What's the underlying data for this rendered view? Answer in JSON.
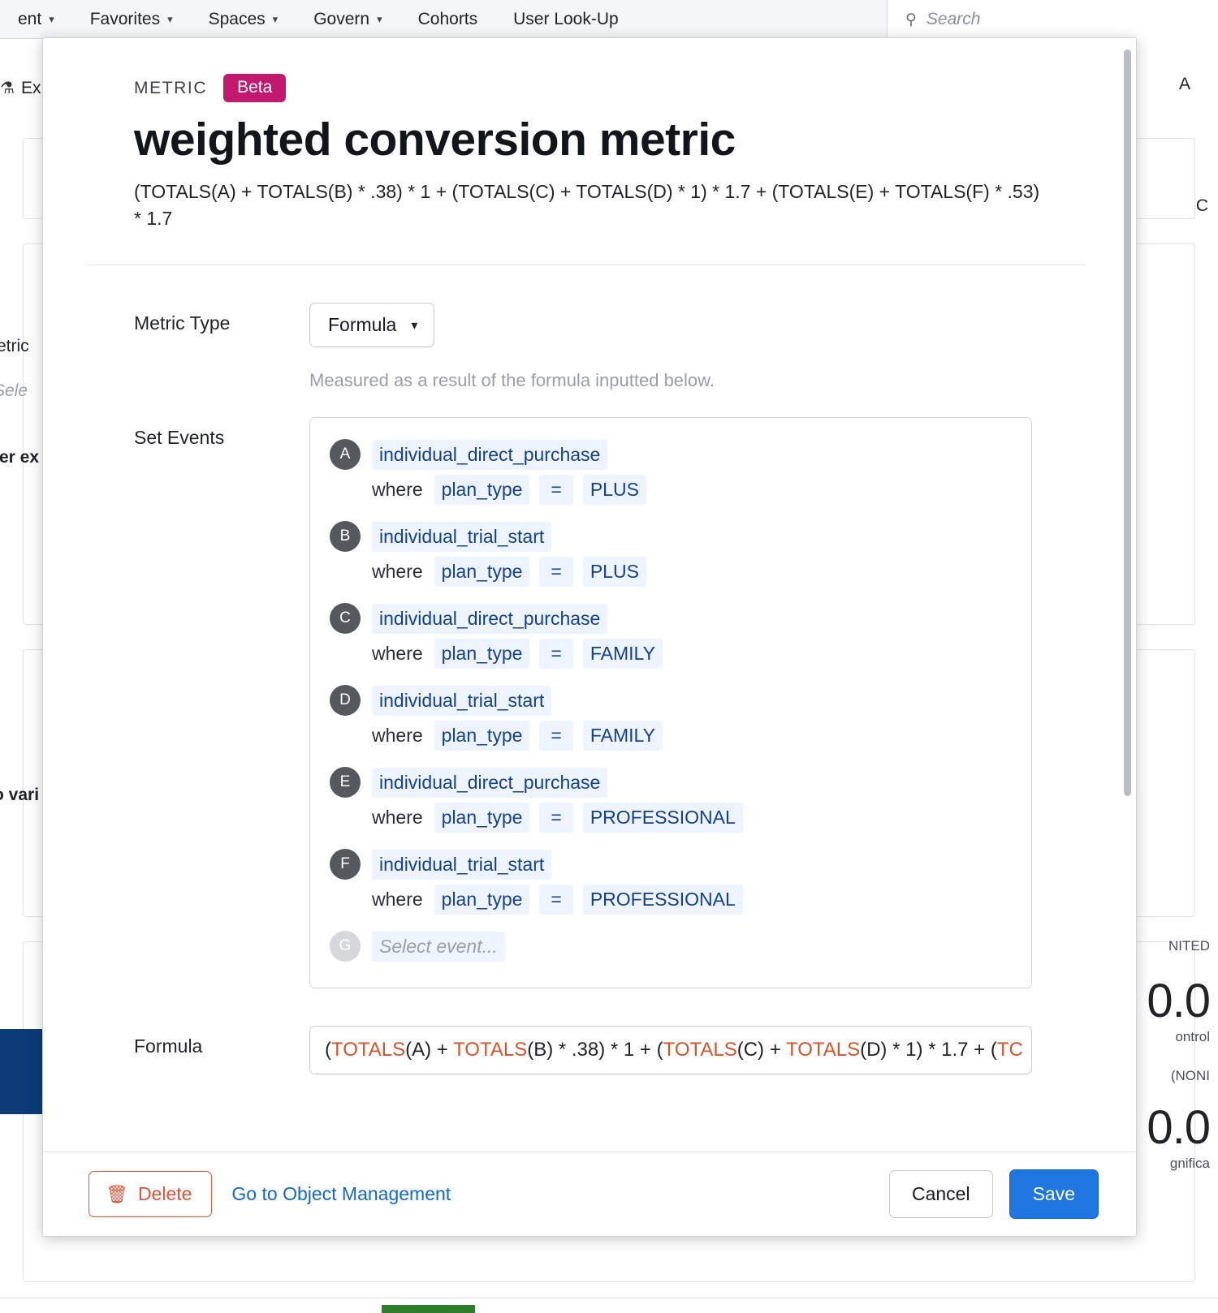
{
  "background": {
    "nav_items": [
      {
        "label": "ent",
        "caret": true
      },
      {
        "label": "Favorites",
        "caret": true
      },
      {
        "label": "Spaces",
        "caret": true
      },
      {
        "label": "Govern",
        "caret": true
      },
      {
        "label": "Cohorts",
        "caret": false
      },
      {
        "label": "User Look-Up",
        "caret": false
      }
    ],
    "search_placeholder": "Search",
    "search_icon": "search-icon",
    "experiment_label": "Ex",
    "right_button": "A",
    "fragments": {
      "metric_label": "etric",
      "select_placeholder": "Sele",
      "filter_exp": "ter ex",
      "variants": "o vari",
      "country": "NITED",
      "none_label": "(NONI",
      "big_value_1": "0.0",
      "big_value_2": "0.0",
      "control_label": "ontrol",
      "significance_label": "gnifica",
      "c_fragment": "C"
    }
  },
  "modal": {
    "eyebrow": "METRIC",
    "badge": "Beta",
    "title": "weighted conversion metric",
    "formula_summary": "(TOTALS(A) + TOTALS(B) * .38) * 1 + (TOTALS(C) + TOTALS(D) * 1) * 1.7 + (TOTALS(E) + TOTALS(F) * .53) * 1.7",
    "metric_type": {
      "label": "Metric Type",
      "value": "Formula",
      "caret_icon": "chevron-down-icon",
      "helper": "Measured as a result of the formula inputted below."
    },
    "set_events": {
      "label": "Set Events",
      "where_word": "where",
      "events": [
        {
          "letter": "A",
          "event": "individual_direct_purchase",
          "property": "plan_type",
          "operator": "=",
          "value": "PLUS"
        },
        {
          "letter": "B",
          "event": "individual_trial_start",
          "property": "plan_type",
          "operator": "=",
          "value": "PLUS"
        },
        {
          "letter": "C",
          "event": "individual_direct_purchase",
          "property": "plan_type",
          "operator": "=",
          "value": "FAMILY"
        },
        {
          "letter": "D",
          "event": "individual_trial_start",
          "property": "plan_type",
          "operator": "=",
          "value": "FAMILY"
        },
        {
          "letter": "E",
          "event": "individual_direct_purchase",
          "property": "plan_type",
          "operator": "=",
          "value": "PROFESSIONAL"
        },
        {
          "letter": "F",
          "event": "individual_trial_start",
          "property": "plan_type",
          "operator": "=",
          "value": "PROFESSIONAL"
        }
      ],
      "empty_row": {
        "letter": "G",
        "placeholder": "Select event..."
      }
    },
    "formula_field": {
      "label": "Formula",
      "segments": [
        {
          "text": "(",
          "keyword": false
        },
        {
          "text": "TOTALS",
          "keyword": true
        },
        {
          "text": "(A) + ",
          "keyword": false
        },
        {
          "text": "TOTALS",
          "keyword": true
        },
        {
          "text": "(B) * .38) * 1 + (",
          "keyword": false
        },
        {
          "text": "TOTALS",
          "keyword": true
        },
        {
          "text": "(C) + ",
          "keyword": false
        },
        {
          "text": "TOTALS",
          "keyword": true
        },
        {
          "text": "(D) * 1) * 1.7 + (",
          "keyword": false
        },
        {
          "text": "TC",
          "keyword": true
        }
      ]
    },
    "footer": {
      "delete_label": "Delete",
      "delete_icon": "trash-icon",
      "object_management_link": "Go to Object Management",
      "cancel_label": "Cancel",
      "save_label": "Save"
    }
  },
  "colors": {
    "beta_badge": "#c2186e",
    "chip_bg": "#eef4fd",
    "chip_text": "#14418f",
    "keyword": "#d4552a",
    "save_button": "#1f76e0",
    "delete_border": "#e2543a",
    "link": "#1268cf"
  }
}
